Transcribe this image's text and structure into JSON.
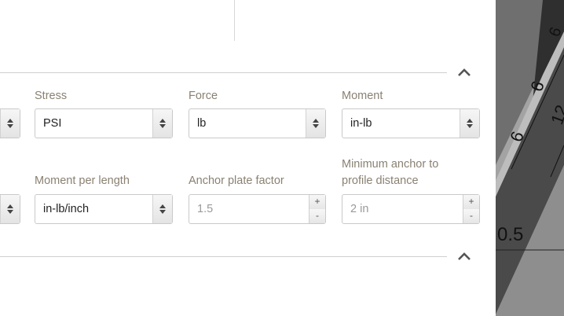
{
  "fields": {
    "stress": {
      "label": "Stress",
      "value": "PSI"
    },
    "force": {
      "label": "Force",
      "value": "lb"
    },
    "moment": {
      "label": "Moment",
      "value": "in-lb"
    },
    "moment_per_length": {
      "label": "Moment per length",
      "value": "in-lb/inch"
    },
    "anchor_plate_factor": {
      "label": "Anchor plate factor",
      "placeholder": "1.5"
    },
    "min_anchor_distance": {
      "label_line1": "Minimum anchor to",
      "label_line2": "profile distance",
      "placeholder": "2 in"
    }
  },
  "spinner": {
    "plus": "+",
    "minus": "-"
  },
  "background_labels": {
    "a": "6",
    "b": "6",
    "c": "6",
    "d": "12",
    "e": "6",
    "f": "0.5"
  },
  "icons": {
    "collapse": "chevron-up-icon",
    "select": "sort-arrows-icon"
  }
}
